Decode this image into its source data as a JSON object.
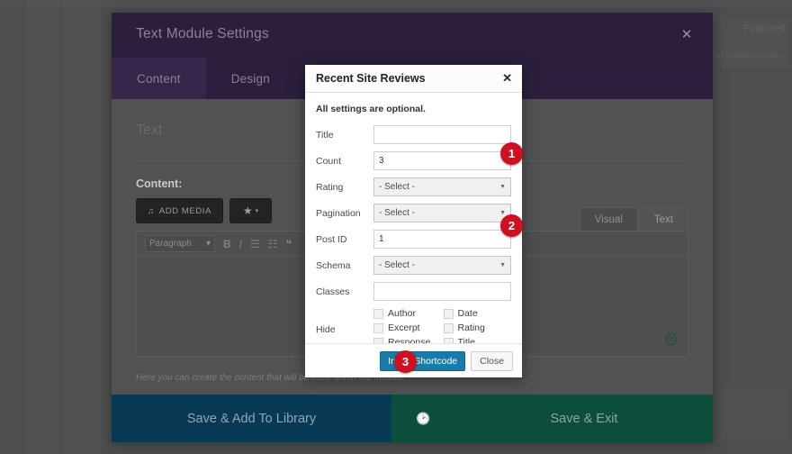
{
  "background": {
    "featured_label": "Featured",
    "featured_sub": "Set featured image"
  },
  "divi_modal": {
    "title": "Text Module Settings",
    "close_icon": "close-icon",
    "tabs": [
      {
        "label": "Content",
        "active": true
      },
      {
        "label": "Design",
        "active": false
      }
    ],
    "section_title": "Text",
    "content_label": "Content:",
    "add_media_label": "ADD MEDIA",
    "add_media_icon": "media-icon",
    "star_icon": "star-icon",
    "star_caret": "▾",
    "editor_tabs": [
      {
        "label": "Visual",
        "active": false
      },
      {
        "label": "Text",
        "active": true
      }
    ],
    "toolbar": {
      "format_select": "Paragraph",
      "caret": "▾",
      "bold": "B",
      "italic": "I",
      "bullet_list": "☰",
      "number_list": "☷",
      "blockquote": "❝"
    },
    "refresh_icon": "refresh-icon",
    "hint": "Here you can create the content that will be used within the module.",
    "footer": {
      "save_library": "Save & Add To Library",
      "preview_icon": "clock-icon",
      "save_exit": "Save & Exit"
    }
  },
  "shortcode_modal": {
    "title": "Recent Site Reviews",
    "close_icon": "close-icon",
    "note": "All settings are optional.",
    "fields": [
      {
        "label": "Title",
        "type": "text",
        "value": "",
        "placeholder": ""
      },
      {
        "label": "Count",
        "type": "text",
        "value": "3",
        "placeholder": ""
      },
      {
        "label": "Rating",
        "type": "select",
        "value": "- Select -"
      },
      {
        "label": "Pagination",
        "type": "select",
        "value": "- Select -"
      },
      {
        "label": "Post ID",
        "type": "text",
        "value": "1",
        "placeholder": ""
      },
      {
        "label": "Schema",
        "type": "select",
        "value": "- Select -"
      },
      {
        "label": "Classes",
        "type": "text",
        "value": "",
        "placeholder": ""
      }
    ],
    "hide": {
      "label": "Hide",
      "options": [
        {
          "label": "Author",
          "checked": false
        },
        {
          "label": "Date",
          "checked": false
        },
        {
          "label": "Excerpt",
          "checked": false
        },
        {
          "label": "Rating",
          "checked": false
        },
        {
          "label": "Response",
          "checked": false
        },
        {
          "label": "Title",
          "checked": false
        }
      ]
    },
    "footer": {
      "insert_label": "Insert Shortcode",
      "close_label": "Close"
    }
  },
  "badges": [
    {
      "number": "1"
    },
    {
      "number": "2"
    },
    {
      "number": "3"
    }
  ],
  "colors": {
    "divi_header": "#2b1f3d",
    "badge_red": "#cf1020",
    "primary_button": "#1a7bab",
    "save_library": "#083a56",
    "save_exit": "#0d4d3e"
  }
}
